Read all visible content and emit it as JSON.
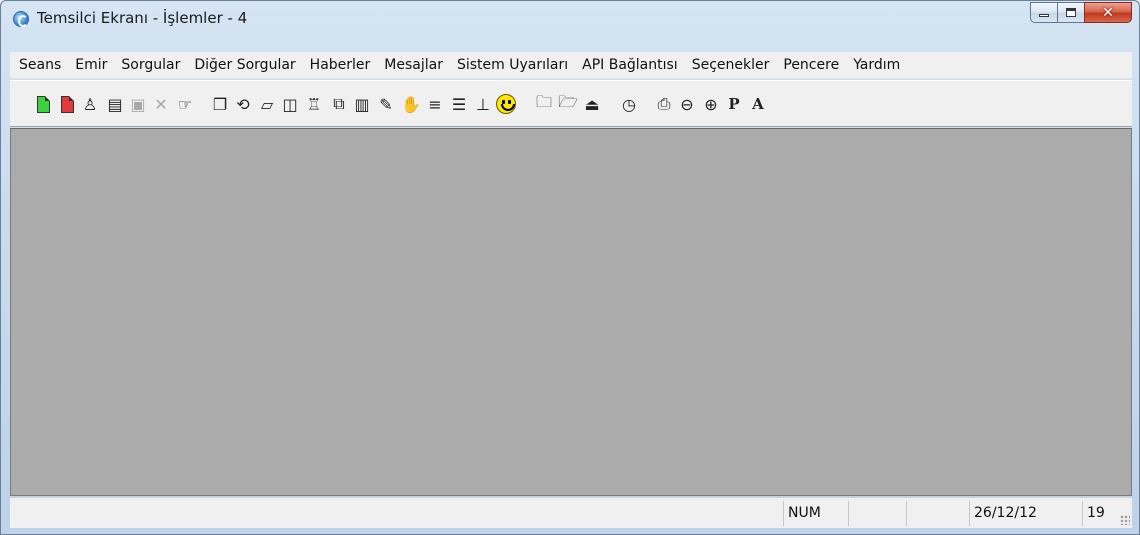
{
  "window": {
    "title": "Temsilci Ekranı - İşlemler - 4"
  },
  "menu": {
    "items": [
      "Seans",
      "Emir",
      "Sorgular",
      "Diğer Sorgular",
      "Haberler",
      "Mesajlar",
      "Sistem Uyarıları",
      "API Bağlantısı",
      "Seçenekler",
      "Pencere",
      "Yardım"
    ]
  },
  "toolbar": {
    "icons": [
      {
        "name": "new-green-doc-icon"
      },
      {
        "name": "new-red-doc-icon"
      },
      {
        "name": "person-icon"
      },
      {
        "name": "stack-icon"
      },
      {
        "name": "properties-icon",
        "state": "disabled"
      },
      {
        "name": "delete-icon",
        "state": "disabled"
      },
      {
        "name": "hand-pointer-icon"
      },
      {
        "name": "window-icon"
      },
      {
        "name": "loop-icon"
      },
      {
        "name": "eraser-icon"
      },
      {
        "name": "columns-icon"
      },
      {
        "name": "lock-icon"
      },
      {
        "name": "copy-icon"
      },
      {
        "name": "paste-icon"
      },
      {
        "name": "notes-icon"
      },
      {
        "name": "hand-stop-icon"
      },
      {
        "name": "align-lines-icon"
      },
      {
        "name": "list-lines-icon"
      },
      {
        "name": "stand-icon"
      },
      {
        "name": "smiley-icon"
      },
      {
        "name": "open-folder-icon"
      },
      {
        "name": "open-folder-2-icon"
      },
      {
        "name": "export-icon"
      },
      {
        "name": "clock-icon"
      },
      {
        "name": "print-icon"
      },
      {
        "name": "zoom-out-icon"
      },
      {
        "name": "zoom-in-icon"
      }
    ],
    "p_label": "P",
    "a_label": "A"
  },
  "status": {
    "num": "NUM",
    "date": "26/12/12",
    "value": "19"
  }
}
